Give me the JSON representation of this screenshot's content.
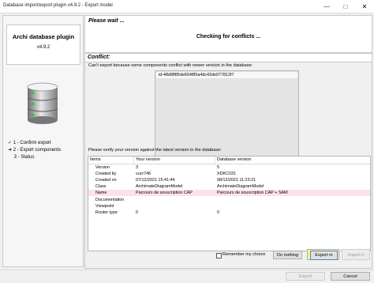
{
  "window": {
    "title": "Database import/export plugin v4.9.2 - Export model",
    "minimize_icon": "minimize-icon",
    "maximize_icon": "maximize-icon",
    "close_icon": "close-icon"
  },
  "sidebar": {
    "plugin_name": "Archi database plugin",
    "plugin_version": "v4.9.2",
    "steps": [
      {
        "marker": "✓",
        "label": "1 - Confirm export"
      },
      {
        "marker": "➜",
        "label": "2 - Export components"
      },
      {
        "marker": "",
        "label": "3 - Status"
      }
    ]
  },
  "please_wait": {
    "title": "Please wait ...",
    "status": "Checking for conflicts ..."
  },
  "conflict": {
    "title": "Conflict:",
    "message": "Can't export because some components conflict with newer version in the database:",
    "ids": [
      "id-48d9ff85de654f85a4dc42de077812f7"
    ],
    "verify_message": "Please verify your version against the latest version in the database:"
  },
  "version_table": {
    "columns": [
      "Items",
      "Your version",
      "Database version"
    ],
    "rows": [
      {
        "item": "Version",
        "yours": "3",
        "db": "5",
        "highlight": false
      },
      {
        "item": "Created by",
        "yours": "vucr746",
        "db": "XDKC031",
        "highlight": false
      },
      {
        "item": "Created on",
        "yours": "07/12/2021 15:41:44",
        "db": "08/12/2021 11:23:21",
        "highlight": false
      },
      {
        "item": "Class",
        "yours": "ArchimateDiagramModel",
        "db": "ArchimateDiagramModel",
        "highlight": false
      },
      {
        "item": "Name",
        "yours": "Parcours de souscription CAP",
        "db": "Parcours de souscription CAP + SAM",
        "highlight": true
      },
      {
        "item": "Documentation",
        "yours": "",
        "db": "",
        "highlight": false
      },
      {
        "item": "Viewpoint",
        "yours": "",
        "db": "",
        "highlight": false
      },
      {
        "item": "Router type",
        "yours": "0",
        "db": "0",
        "highlight": false
      }
    ]
  },
  "actions": {
    "remember_label": "Remember my choice",
    "remember_checked": false,
    "do_nothing_label": "Do nothing",
    "export_label": "Export m",
    "import_label": "Import it"
  },
  "bottom": {
    "export_label": "Export",
    "cancel_label": "Cancel"
  },
  "colors": {
    "highlight_row": "#fde2e6",
    "button_highlight": "#fff580"
  }
}
